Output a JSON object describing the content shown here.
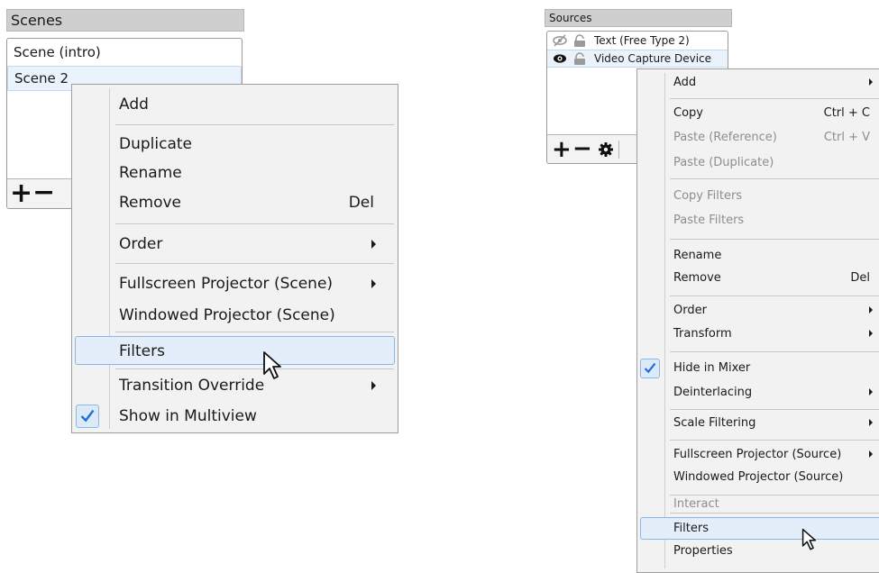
{
  "scenes": {
    "title": "Scenes",
    "items": [
      {
        "label": "Scene (intro)",
        "selected": false
      },
      {
        "label": "Scene 2",
        "selected": true
      }
    ],
    "toolbar": {
      "add_icon": "plus-icon",
      "remove_icon": "minus-icon"
    }
  },
  "sources": {
    "title": "Sources",
    "items": [
      {
        "label": "Text (Free Type 2)",
        "visible": false,
        "locked": false
      },
      {
        "label": "Video Capture Device",
        "visible": true,
        "locked": false
      }
    ],
    "toolbar": {
      "add_icon": "plus-icon",
      "remove_icon": "minus-icon",
      "settings_icon": "gear-icon"
    }
  },
  "scene_menu": {
    "items": {
      "add": "Add",
      "duplicate": "Duplicate",
      "rename": "Rename",
      "remove": "Remove",
      "remove_shortcut": "Del",
      "order": "Order",
      "fullscreen_projector": "Fullscreen Projector (Scene)",
      "windowed_projector": "Windowed Projector (Scene)",
      "filters": "Filters",
      "transition_override": "Transition Override",
      "show_in_multiview": "Show in Multiview"
    },
    "highlighted": "filters",
    "checked": [
      "show_in_multiview"
    ]
  },
  "source_menu": {
    "items": {
      "add": "Add",
      "copy": "Copy",
      "copy_shortcut": "Ctrl + C",
      "paste_reference": "Paste (Reference)",
      "paste_reference_shortcut": "Ctrl + V",
      "paste_duplicate": "Paste (Duplicate)",
      "copy_filters": "Copy Filters",
      "paste_filters": "Paste Filters",
      "rename": "Rename",
      "remove": "Remove",
      "remove_shortcut": "Del",
      "order": "Order",
      "transform": "Transform",
      "hide_in_mixer": "Hide in Mixer",
      "deinterlacing": "Deinterlacing",
      "scale_filtering": "Scale Filtering",
      "fullscreen_projector": "Fullscreen Projector (Source)",
      "windowed_projector": "Windowed Projector (Source)",
      "interact": "Interact",
      "filters": "Filters",
      "properties": "Properties"
    },
    "disabled": [
      "paste_reference",
      "paste_duplicate",
      "copy_filters",
      "paste_filters",
      "interact"
    ],
    "highlighted": "filters",
    "checked": [
      "hide_in_mixer"
    ]
  },
  "colors": {
    "menu_bg": "#f2f2f2",
    "highlight_bg": "#e3eefa",
    "highlight_border": "#8db7e3",
    "check_color": "#1f6fd6",
    "dock_title_bg": "#cfcfcf",
    "disabled_text": "#8d8d8d"
  }
}
